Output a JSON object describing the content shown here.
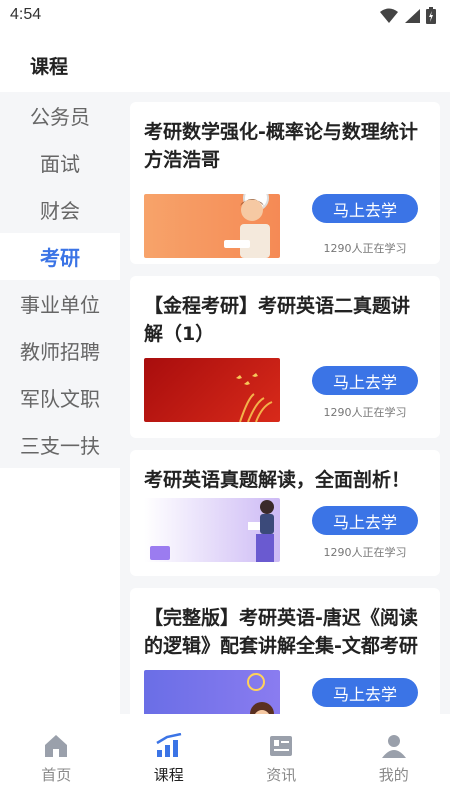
{
  "status": {
    "time": "4:54"
  },
  "page": {
    "title": "课程"
  },
  "sidebar": {
    "items": [
      {
        "label": "公务员"
      },
      {
        "label": "面试"
      },
      {
        "label": "财会"
      },
      {
        "label": "考研",
        "active": true
      },
      {
        "label": "事业单位"
      },
      {
        "label": "教师招聘"
      },
      {
        "label": "军队文职"
      },
      {
        "label": "三支一扶"
      }
    ]
  },
  "courses": [
    {
      "title": "考研数学强化-概率论与数理统计方浩浩哥",
      "button": "马上去学",
      "learners": "1290人正在学习"
    },
    {
      "title": "【金程考研】考研英语二真题讲解（1）",
      "button": "马上去学",
      "learners": "1290人正在学习"
    },
    {
      "title": "考研英语真题解读，全面剖析！",
      "button": "马上去学",
      "learners": "1290人正在学习"
    },
    {
      "title": "【完整版】考研英语-唐迟《阅读的逻辑》配套讲解全集-文都考研",
      "button": "马上去学",
      "learners": ""
    }
  ],
  "bottom_nav": {
    "items": [
      {
        "label": "首页",
        "icon": "home-icon"
      },
      {
        "label": "课程",
        "icon": "course-icon",
        "active": true
      },
      {
        "label": "资讯",
        "icon": "news-icon"
      },
      {
        "label": "我的",
        "icon": "profile-icon"
      }
    ]
  },
  "colors": {
    "accent": "#3b74e6",
    "background": "#f5f6f8",
    "muted": "#8a8a8a"
  }
}
